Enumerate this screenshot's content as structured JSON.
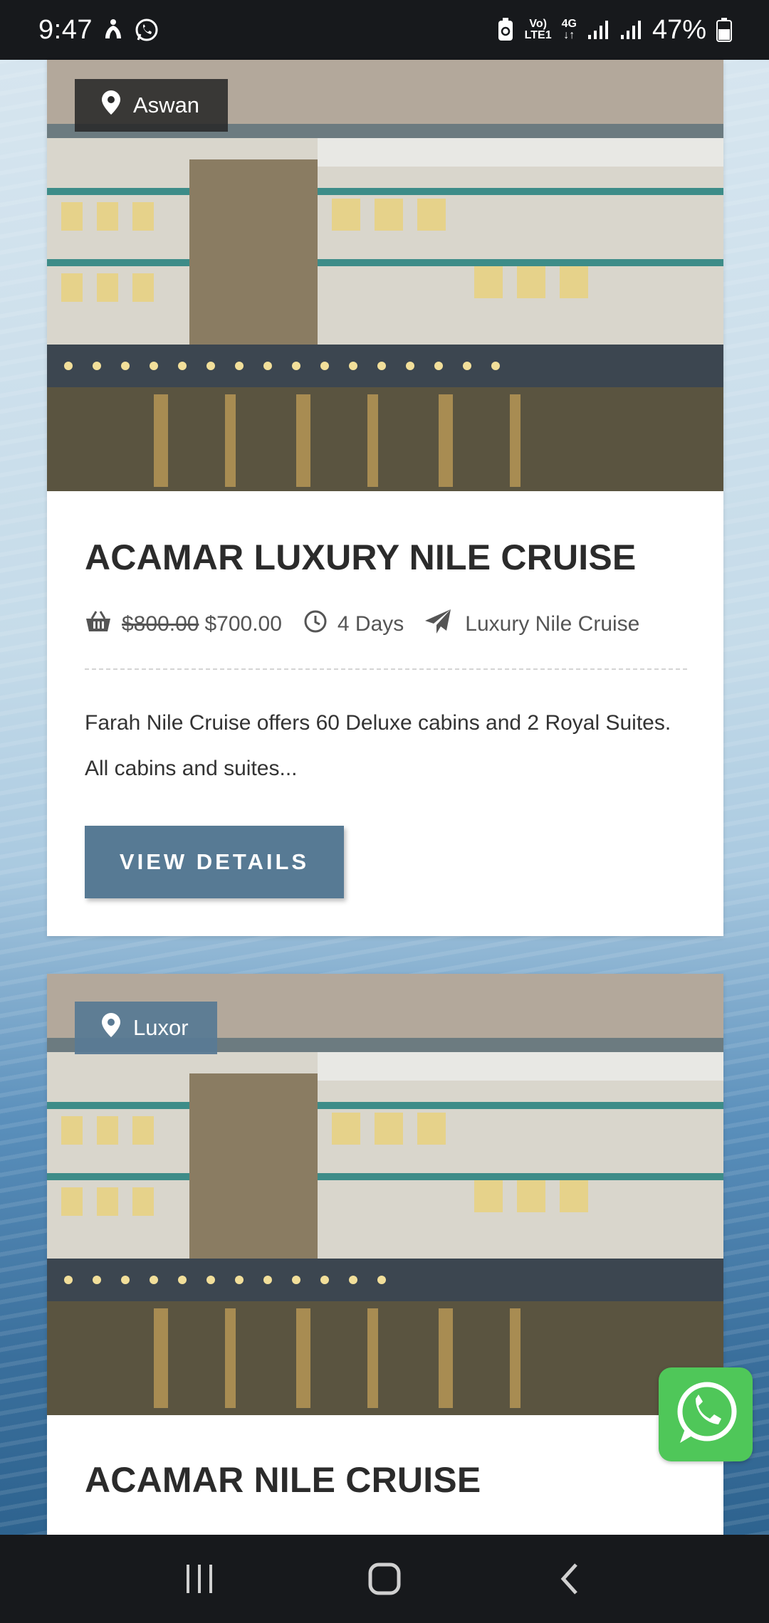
{
  "status_bar": {
    "time": "9:47",
    "network_top": "Vo)",
    "network_bottom": "LTE1",
    "network_type": "4G",
    "battery_percent": "47%",
    "icons": [
      "accessibility-icon",
      "whatsapp-icon",
      "battery-saver-icon",
      "volte-icon",
      "data-arrows-icon",
      "signal-icon",
      "signal-icon",
      "battery-icon"
    ]
  },
  "cards": [
    {
      "location": "Aswan",
      "title": "ACAMAR LUXURY NILE CRUISE",
      "price_old": "$800.00",
      "price_new": "$700.00",
      "duration": "4 Days",
      "category": "Luxury Nile Cruise",
      "excerpt": "Farah Nile Cruise offers 60 Deluxe cabins and 2 Royal Suites. All cabins and suites...",
      "button_label": "VIEW DETAILS"
    },
    {
      "location": "Luxor",
      "title": "ACAMAR NILE CRUISE"
    }
  ],
  "colors": {
    "accent": "#577a94",
    "status_bar": "#17191c",
    "whatsapp": "#4fc759"
  }
}
